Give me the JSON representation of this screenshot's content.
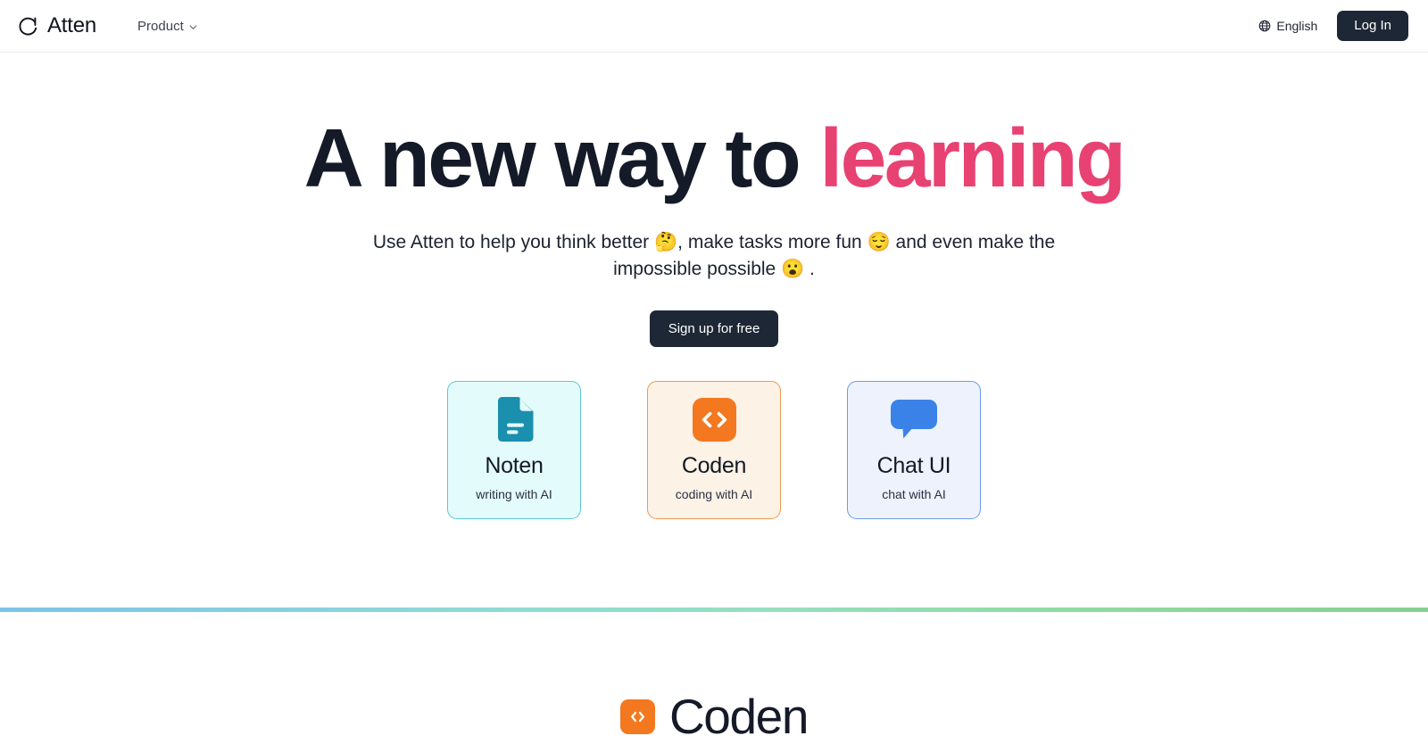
{
  "header": {
    "logo_icon": "atten-mark-icon",
    "brand_name": "Atten",
    "nav": [
      {
        "label": "Product",
        "icon": "chevron-down-icon"
      }
    ],
    "language": {
      "label": "English",
      "icon": "globe-icon"
    },
    "login_label": "Log In"
  },
  "hero": {
    "headline_plain": "A new way to ",
    "headline_accent": "learning",
    "accent_color": "#e84272",
    "subhead": "Use Atten to help you think better 🤔, make tasks more fun 😌 and even make the impossible possible 😮 .",
    "cta_label": "Sign up for free"
  },
  "cards": [
    {
      "title": "Noten",
      "subtitle": "writing with AI",
      "icon": "document-icon",
      "icon_color": "#1a8fae",
      "bg": "#e4fbfb",
      "border": "#5cc6da"
    },
    {
      "title": "Coden",
      "subtitle": "coding with AI",
      "icon": "code-brackets-icon",
      "icon_color": "#f4781f",
      "bg": "#fdf2e6",
      "border": "#eb9a4e"
    },
    {
      "title": "Chat UI",
      "subtitle": "chat with AI",
      "icon": "chat-bubble-icon",
      "icon_color": "#3b82e8",
      "bg": "#eef2fd",
      "border": "#6c9ce6"
    }
  ],
  "divider": {
    "gradient_start": "#7cc3e8",
    "gradient_end": "#86cf92"
  },
  "bottom_section": {
    "logo_icon": "code-brackets-icon",
    "logo_bg": "#f4781f",
    "title": "Coden"
  }
}
